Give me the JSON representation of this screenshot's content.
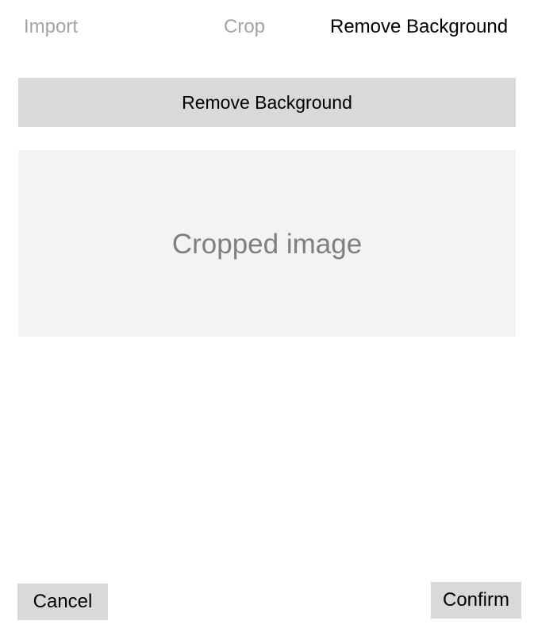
{
  "steps": [
    {
      "label": "Import",
      "state": "inactive"
    },
    {
      "label": "Crop",
      "state": "inactive"
    },
    {
      "label": "Remove Background",
      "state": "active"
    }
  ],
  "toolbar": {
    "remove_background_label": "Remove Background"
  },
  "preview": {
    "placeholder": "Cropped image"
  },
  "footer": {
    "cancel_label": "Cancel",
    "confirm_label": "Confirm"
  },
  "colors": {
    "inactive_step": "#a3a3a3",
    "active_step": "#000000",
    "button_bg": "#d9d9d9",
    "preview_bg": "#f3f3f3",
    "placeholder_text": "#7f7f7f"
  }
}
